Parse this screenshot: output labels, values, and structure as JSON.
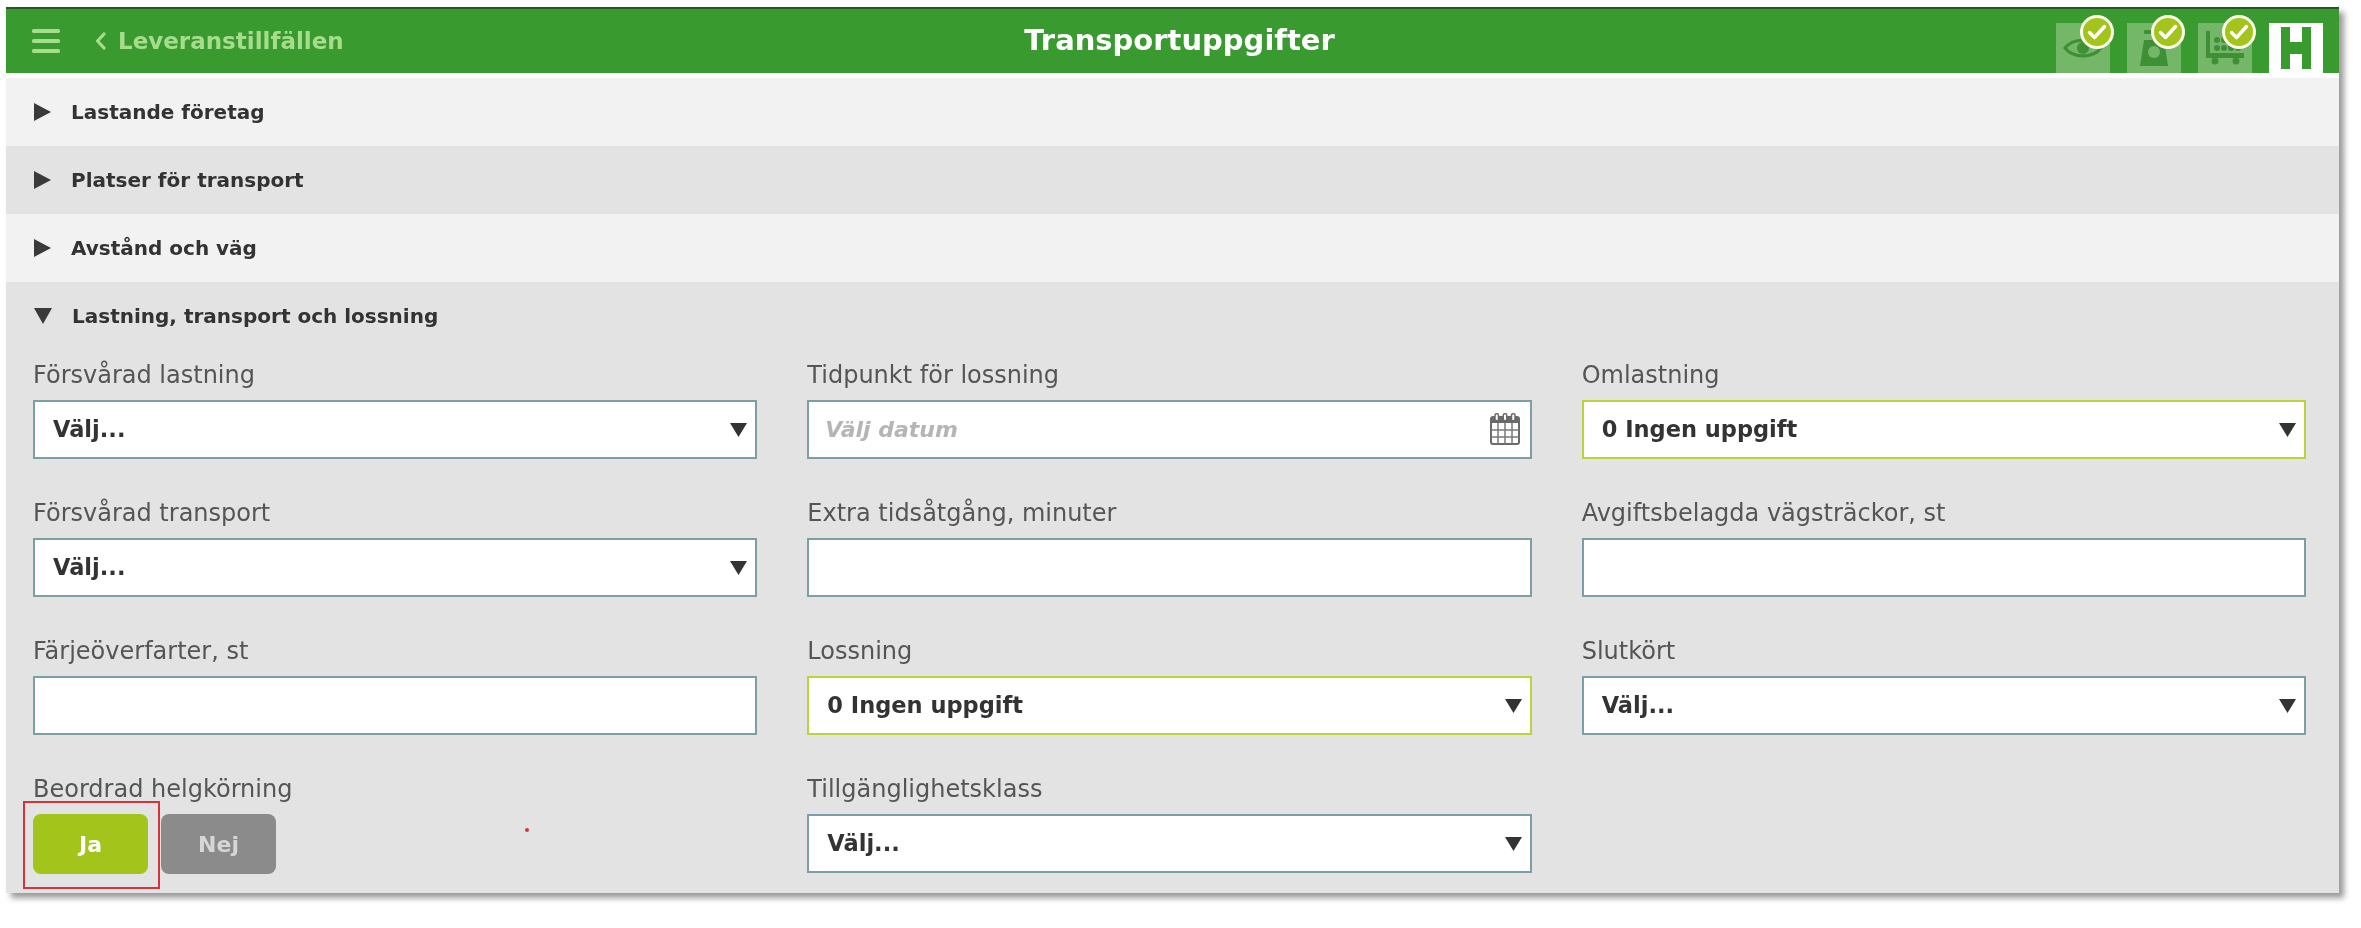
{
  "header": {
    "back_label": "Leveranstillfällen",
    "title": "Transportuppgifter",
    "step_tabs": [
      {
        "kind": "eye",
        "done": true,
        "selected": false
      },
      {
        "kind": "scale",
        "done": true,
        "selected": false
      },
      {
        "kind": "cart",
        "done": true,
        "selected": false
      },
      {
        "kind": "road",
        "done": false,
        "selected": true
      }
    ]
  },
  "sections": [
    {
      "title": "Lastande företag",
      "expanded": false
    },
    {
      "title": "Platser för transport",
      "expanded": false
    },
    {
      "title": "Avstånd och väg",
      "expanded": false
    },
    {
      "title": "Lastning, transport och lossning",
      "expanded": true,
      "fields": [
        {
          "kind": "select",
          "label": "Försvårad lastning",
          "value": "Välj...",
          "highlighted": false
        },
        {
          "kind": "date",
          "label": "Tidpunkt för lossning",
          "placeholder": "Välj datum",
          "highlighted": false
        },
        {
          "kind": "select",
          "label": "Omlastning",
          "value": "0 Ingen uppgift",
          "highlighted": true
        },
        {
          "kind": "select",
          "label": "Försvårad transport",
          "value": "Välj...",
          "highlighted": false
        },
        {
          "kind": "input",
          "label": "Extra tidsåtgång, minuter",
          "highlighted": false
        },
        {
          "kind": "input",
          "label": "Avgiftsbelagda vägsträckor, st",
          "highlighted": false
        },
        {
          "kind": "input",
          "label": "Färjeöverfarter, st",
          "highlighted": false
        },
        {
          "kind": "select",
          "label": "Lossning",
          "value": "0 Ingen uppgift",
          "highlighted": true
        },
        {
          "kind": "select",
          "label": "Slutkört",
          "value": "Välj...",
          "highlighted": false
        },
        {
          "kind": "toggle",
          "label": "Beordrad helgkörning",
          "options": [
            {
              "label": "Ja",
              "selected": true
            },
            {
              "label": "Nej",
              "selected": false
            }
          ],
          "annotated": true,
          "stray_mark": true
        },
        {
          "kind": "select",
          "label": "Tillgänglighetsklass",
          "value": "Välj...",
          "highlighted": false
        }
      ]
    }
  ]
}
